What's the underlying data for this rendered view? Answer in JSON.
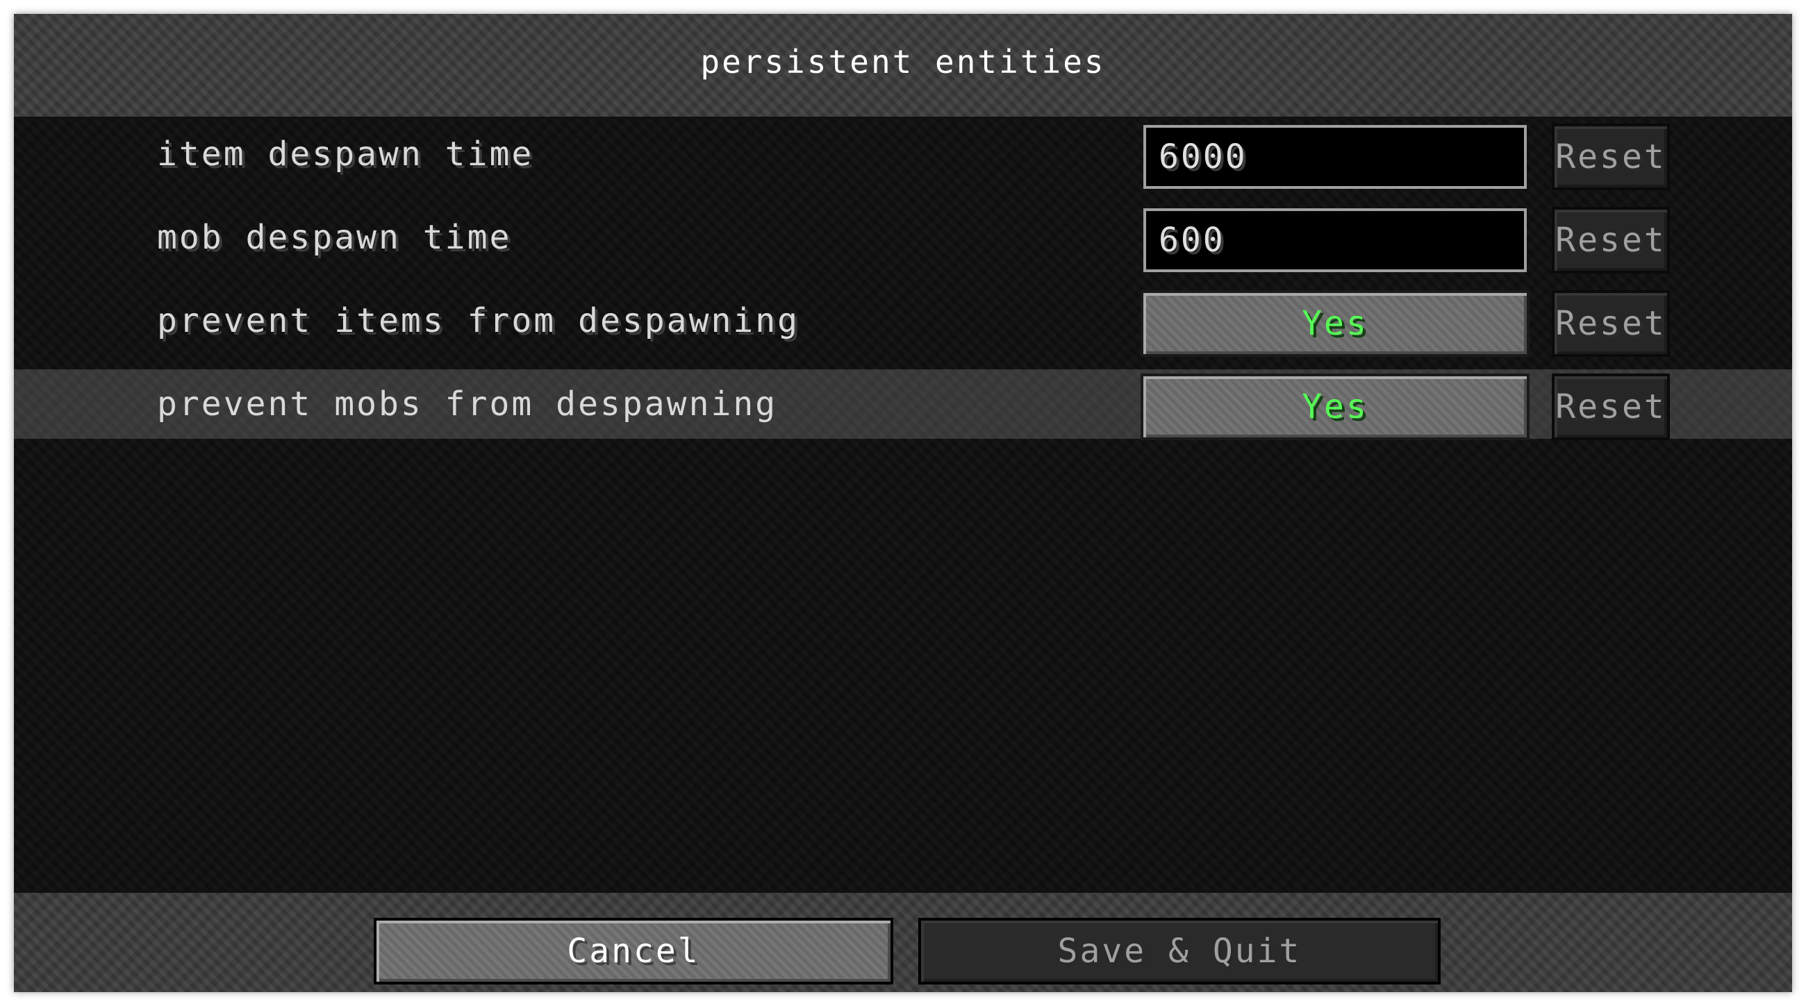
{
  "screen": {
    "title": "persistent entities"
  },
  "settings": [
    {
      "label": "item despawn time",
      "type": "text",
      "value": "6000",
      "reset_label": "Reset",
      "highlighted": false
    },
    {
      "label": "mob despawn time",
      "type": "text",
      "value": "600",
      "reset_label": "Reset",
      "highlighted": false
    },
    {
      "label": "prevent items from despawning",
      "type": "toggle",
      "value": "Yes",
      "reset_label": "Reset",
      "highlighted": false
    },
    {
      "label": "prevent mobs from despawning",
      "type": "toggle",
      "value": "Yes",
      "reset_label": "Reset",
      "highlighted": true
    }
  ],
  "footer": {
    "cancel_label": "Cancel",
    "save_quit_label": "Save & Quit",
    "save_quit_enabled": false
  },
  "colors": {
    "toggle_on_text": "#55ff55",
    "label_text": "#d9d9d9",
    "disabled_text": "#a0a0a0"
  }
}
